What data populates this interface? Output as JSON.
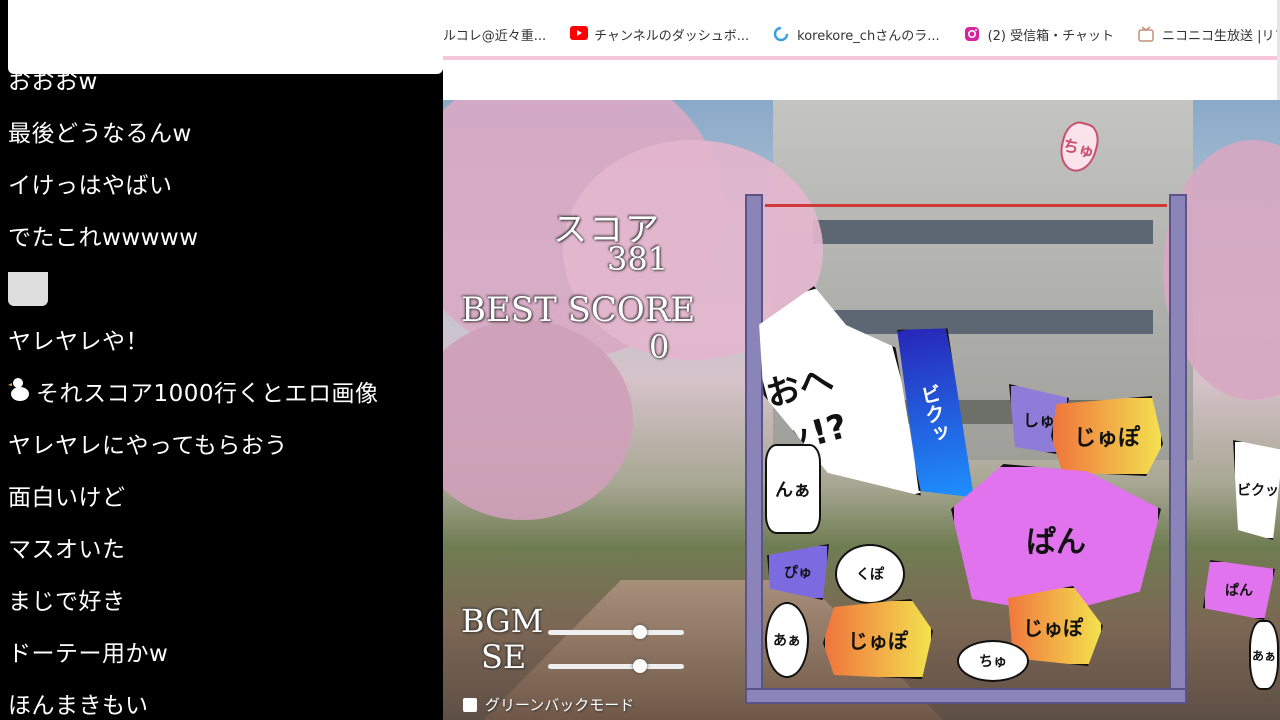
{
  "comments": [
    {
      "text": "おおおw"
    },
    {
      "text": "最後どうなるんw"
    },
    {
      "text": "イけっはやばい"
    },
    {
      "text": "でたこれwwwww"
    },
    {
      "text": ""
    },
    {
      "text": "ヤレヤレや！"
    },
    {
      "text": "それスコア1000行くとエロ画像"
    },
    {
      "text": "ヤレヤレにやってもらおう"
    },
    {
      "text": "面白いけど"
    },
    {
      "text": "マスオいた"
    },
    {
      "text": "まじで好き"
    },
    {
      "text": "ドーテー用かw"
    },
    {
      "text": "ほんまきもい"
    }
  ],
  "bookmarks": [
    {
      "label": "ルコレ@近々重...",
      "icon": "generic-icon",
      "color": "#999999"
    },
    {
      "label": "チャンネルのダッシュボ...",
      "icon": "youtube-icon",
      "color": "#ff0000"
    },
    {
      "label": "korekore_chさんのラ...",
      "icon": "spiral-icon",
      "color": "#3aa0e0"
    },
    {
      "label": "(2) 受信箱・チャット",
      "icon": "instagram-icon",
      "color": "#d6249f"
    },
    {
      "label": "ニコニコ生放送 |リアル...",
      "icon": "niconico-icon",
      "color": "#c69079"
    }
  ],
  "game": {
    "score_label": "スコア",
    "score_value": "381",
    "best_label": "BEST SCORE",
    "best_value": "0",
    "bgm_label": "BGM",
    "se_label": "SE",
    "bgm_level": 0.68,
    "se_level": 0.68,
    "greenback_label": "グリーンバックモード",
    "falling_piece": "ちゅ",
    "pieces": [
      "おへッ!?",
      "ビクッ",
      "んぁ",
      "しゅ",
      "じゅぽ",
      "ぱん",
      "くぽ",
      "あぁ",
      "ちゅ",
      "ぴゅ"
    ]
  }
}
